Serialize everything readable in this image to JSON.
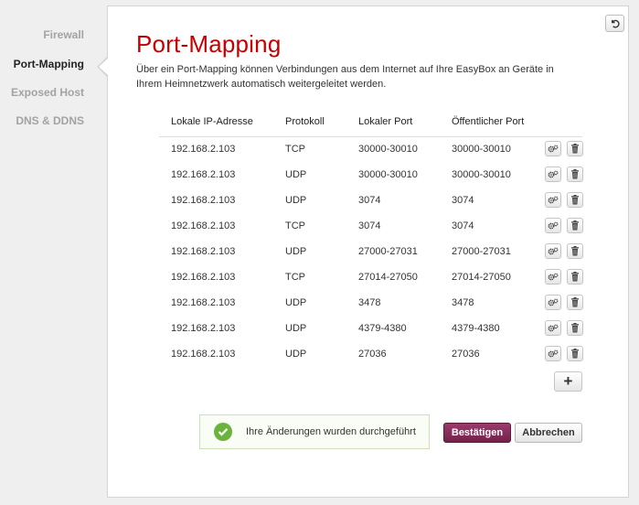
{
  "sidebar": {
    "items": [
      {
        "label": "Firewall"
      },
      {
        "label": "Port-Mapping"
      },
      {
        "label": "Exposed Host"
      },
      {
        "label": "DNS & DDNS"
      }
    ]
  },
  "panel": {
    "title": "Port-Mapping",
    "description": "Über ein Port-Mapping können Verbindungen aus dem Internet auf Ihre EasyBox an Geräte in Ihrem Heimnetzwerk automatisch weitergeleitet werden."
  },
  "table": {
    "headers": [
      "Lokale IP-Adresse",
      "Protokoll",
      "Lokaler Port",
      "Öffentlicher Port"
    ],
    "rows": [
      {
        "ip": "192.168.2.103",
        "protocol": "TCP",
        "local_port": "30000-30010",
        "public_port": "30000-30010"
      },
      {
        "ip": "192.168.2.103",
        "protocol": "UDP",
        "local_port": "30000-30010",
        "public_port": "30000-30010"
      },
      {
        "ip": "192.168.2.103",
        "protocol": "UDP",
        "local_port": "3074",
        "public_port": "3074"
      },
      {
        "ip": "192.168.2.103",
        "protocol": "TCP",
        "local_port": "3074",
        "public_port": "3074"
      },
      {
        "ip": "192.168.2.103",
        "protocol": "UDP",
        "local_port": "27000-27031",
        "public_port": "27000-27031"
      },
      {
        "ip": "192.168.2.103",
        "protocol": "TCP",
        "local_port": "27014-27050",
        "public_port": "27014-27050"
      },
      {
        "ip": "192.168.2.103",
        "protocol": "UDP",
        "local_port": "3478",
        "public_port": "3478"
      },
      {
        "ip": "192.168.2.103",
        "protocol": "UDP",
        "local_port": "4379-4380",
        "public_port": "4379-4380"
      },
      {
        "ip": "192.168.2.103",
        "protocol": "UDP",
        "local_port": "27036",
        "public_port": "27036"
      }
    ]
  },
  "notification": {
    "text": "Ihre Änderungen wurden durchgeführt",
    "icon": "check-icon"
  },
  "buttons": {
    "confirm": "Bestätigen",
    "cancel": "Abbrechen",
    "add": "+"
  },
  "icons": {
    "undo": "undo-icon",
    "edit": "gear-icon",
    "delete": "trash-icon"
  },
  "colors": {
    "title": "#c50000",
    "confirm_button": "#8a2f5c",
    "success": "#6ab43e",
    "active_nav": "#222222",
    "inactive_nav": "#a3a3a3"
  }
}
